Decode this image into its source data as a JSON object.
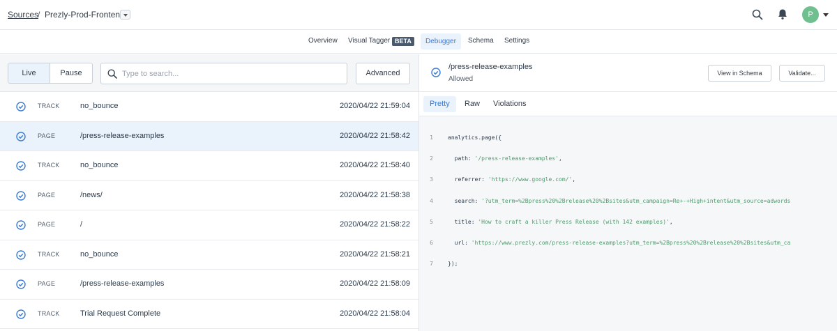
{
  "breadcrumb": {
    "sources_label": "Sources",
    "separator": "/",
    "source_name": "Prezly-Prod-Frontend"
  },
  "header": {
    "avatar_initial": "P"
  },
  "nav_tabs": [
    {
      "label": "Overview"
    },
    {
      "label": "Visual Tagger",
      "badge": "BETA"
    },
    {
      "label": "Debugger",
      "active": true
    },
    {
      "label": "Schema"
    },
    {
      "label": "Settings"
    }
  ],
  "controls": {
    "live_label": "Live",
    "pause_label": "Pause",
    "search_placeholder": "Type to search...",
    "advanced_label": "Advanced"
  },
  "events": [
    {
      "type": "TRACK",
      "name": "no_bounce",
      "time": "2020/04/22 21:59:04"
    },
    {
      "type": "PAGE",
      "name": "/press-release-examples",
      "time": "2020/04/22 21:58:42",
      "selected": true
    },
    {
      "type": "TRACK",
      "name": "no_bounce",
      "time": "2020/04/22 21:58:40"
    },
    {
      "type": "PAGE",
      "name": "/news/",
      "time": "2020/04/22 21:58:38"
    },
    {
      "type": "PAGE",
      "name": "/",
      "time": "2020/04/22 21:58:22"
    },
    {
      "type": "TRACK",
      "name": "no_bounce",
      "time": "2020/04/22 21:58:21"
    },
    {
      "type": "PAGE",
      "name": "/press-release-examples",
      "time": "2020/04/22 21:58:09"
    },
    {
      "type": "TRACK",
      "name": "Trial Request Complete",
      "time": "2020/04/22 21:58:04"
    }
  ],
  "detail": {
    "event_name": "/press-release-examples",
    "status": "Allowed",
    "view_schema_label": "View in Schema",
    "validate_label": "Validate...",
    "tabs": [
      {
        "label": "Pretty",
        "active": true
      },
      {
        "label": "Raw"
      },
      {
        "label": "Violations"
      }
    ],
    "code_lines": [
      {
        "num": "1",
        "plain": "analytics.page({",
        "str": "",
        "tail": ""
      },
      {
        "num": "2",
        "plain": "  path: ",
        "str": "'/press-release-examples'",
        "tail": ","
      },
      {
        "num": "3",
        "plain": "  referrer: ",
        "str": "'https://www.google.com/'",
        "tail": ","
      },
      {
        "num": "4",
        "plain": "  search: ",
        "str": "'?utm_term=%2Bpress%20%2Brelease%20%2Bsites&utm_campaign=Re+-+High+intent&utm_source=adwords",
        "tail": ""
      },
      {
        "num": "5",
        "plain": "  title: ",
        "str": "'How to craft a killer Press Release (with 142 examples)'",
        "tail": ","
      },
      {
        "num": "6",
        "plain": "  url: ",
        "str": "'https://www.prezly.com/press-release-examples?utm_term=%2Bpress%20%2Brelease%20%2Bsites&utm_ca",
        "tail": ""
      },
      {
        "num": "7",
        "plain": "});",
        "str": "",
        "tail": ""
      }
    ]
  },
  "colors": {
    "accent": "#3b7bd4",
    "selected_row": "#eaf2fb",
    "string": "#4c9a6b",
    "avatar": "#6fbf8f"
  }
}
